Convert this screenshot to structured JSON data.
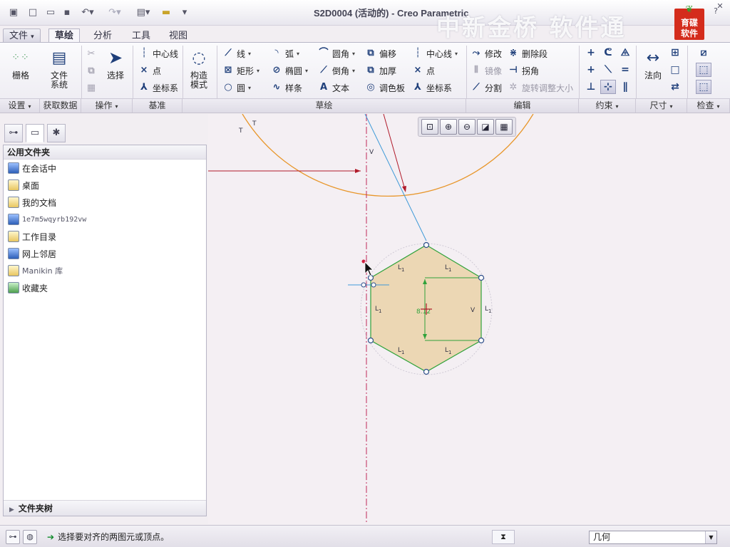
{
  "window": {
    "title": "S2D0004 (活动的) - Creo Parametric",
    "watermark": "中新金桥 软件通",
    "logo_text": "育碟\n软件",
    "quick_access": [
      "app-icon",
      "new-icon",
      "open-icon",
      "save-icon",
      "undo-icon",
      "redo-icon",
      "window-icon",
      "folder-icon",
      "customize-icon"
    ]
  },
  "tabs": [
    {
      "label": "文件",
      "dropdown": "▾"
    },
    {
      "label": "草绘",
      "active": true
    },
    {
      "label": "分析"
    },
    {
      "label": "工具"
    },
    {
      "label": "视图"
    }
  ],
  "ribbon": {
    "setup": {
      "grid": "栅格",
      "file_system": "文件\n系统"
    },
    "operations": {
      "select": "选择",
      "cut": "cut-icon",
      "copy": "copy-icon",
      "paste": "paste-icon"
    },
    "datum": {
      "centerline": "中心线",
      "point": "点",
      "coord_sys": "坐标系"
    },
    "construction": "构造\n模式",
    "sketch": {
      "line": "线",
      "arc": "弧",
      "fillet": "圆角",
      "offset": "偏移",
      "centerline": "中心线",
      "rectangle": "矩形",
      "ellipse": "椭圆",
      "chamfer": "倒角",
      "thicken": "加厚",
      "point": "点",
      "circle": "圆",
      "spline": "样条",
      "text": "文本",
      "palette": "调色板",
      "coord_sys": "坐标系"
    },
    "edit": {
      "modify": "修改",
      "delete_segment": "删除段",
      "mirror": "镜像",
      "corner": "拐角",
      "divide": "分割",
      "rotate_resize": "旋转调整大小"
    },
    "dimension": {
      "normal": "法向"
    },
    "groups": [
      {
        "label": "设置",
        "dropdown": "▾"
      },
      {
        "label": "获取数据"
      },
      {
        "label": "操作",
        "dropdown": "▾"
      },
      {
        "label": "基准"
      },
      {
        "label": "草绘"
      },
      {
        "label": "编辑"
      },
      {
        "label": "约束",
        "dropdown": "▾"
      },
      {
        "label": "尺寸",
        "dropdown": "▾"
      },
      {
        "label": "检查",
        "dropdown": "▾"
      }
    ]
  },
  "navigator": {
    "header": "公用文件夹",
    "items": [
      {
        "label": "在会话中",
        "icon": "session-icon"
      },
      {
        "label": "桌面",
        "icon": "desktop-icon"
      },
      {
        "label": "我的文档",
        "icon": "documents-icon"
      },
      {
        "label": "1e7m5wqyrb192vw",
        "icon": "computer-icon",
        "mono": true
      },
      {
        "label": "工作目录",
        "icon": "working-dir-icon"
      },
      {
        "label": "网上邻居",
        "icon": "network-icon"
      },
      {
        "label": "Manikin 库",
        "icon": "manikin-icon"
      },
      {
        "label": "收藏夹",
        "icon": "favorites-icon"
      }
    ],
    "folder_tree": "文件夹树"
  },
  "sketch": {
    "labels": {
      "L": "L",
      "sub": "1",
      "V": "V",
      "T": "T",
      "dim": "8.12"
    },
    "colors": {
      "hex_fill": "#ecd7b4",
      "hex_edge": "#2fa23a",
      "arc": "#e8962a",
      "axis": "#c0285a",
      "ray": "#3f9ad8",
      "arrow": "#b01a2a"
    }
  },
  "status": {
    "message": "选择要对齐的两图元或顶点。",
    "filter": "几何"
  }
}
